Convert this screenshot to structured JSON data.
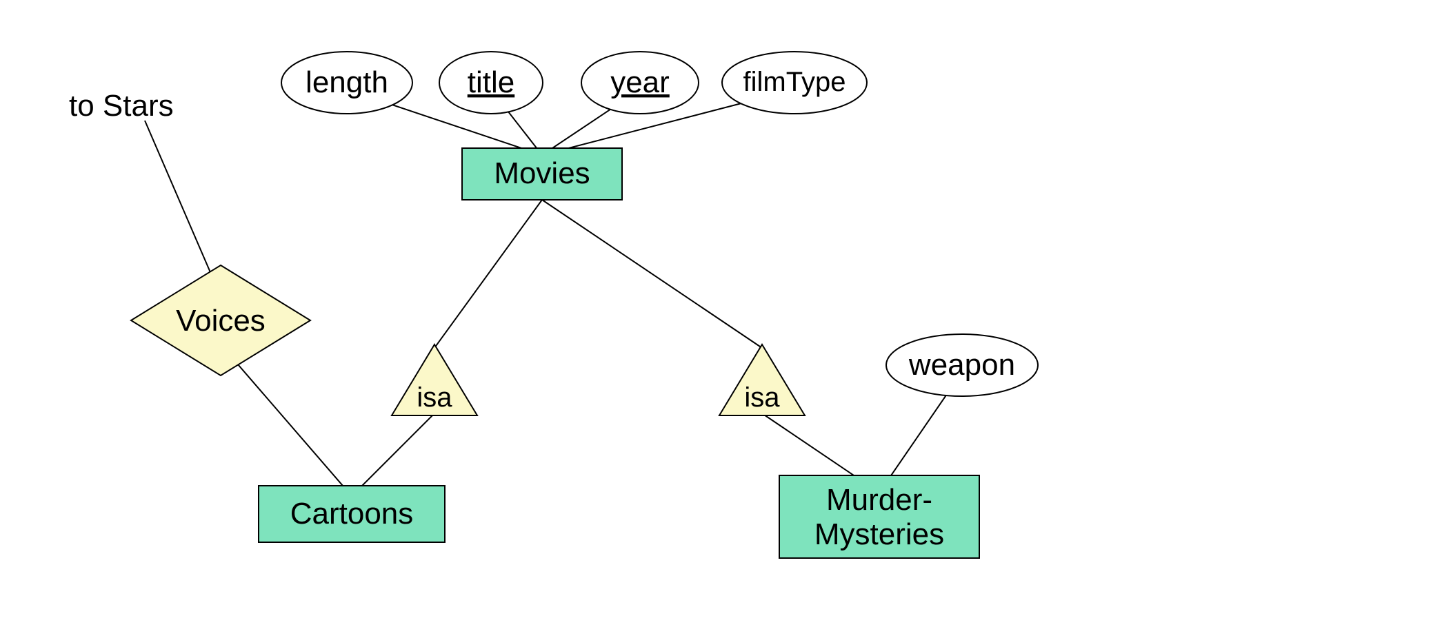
{
  "external": {
    "toStars": "to Stars"
  },
  "entities": {
    "movies": "Movies",
    "cartoons": "Cartoons",
    "murderMysteries1": "Murder-",
    "murderMysteries2": "Mysteries"
  },
  "attributes": {
    "length": "length",
    "title": "title",
    "year": "year",
    "filmType": "filmType",
    "weapon": "weapon"
  },
  "relationships": {
    "voices": "Voices"
  },
  "isa": {
    "left": "isa",
    "right": "isa"
  }
}
